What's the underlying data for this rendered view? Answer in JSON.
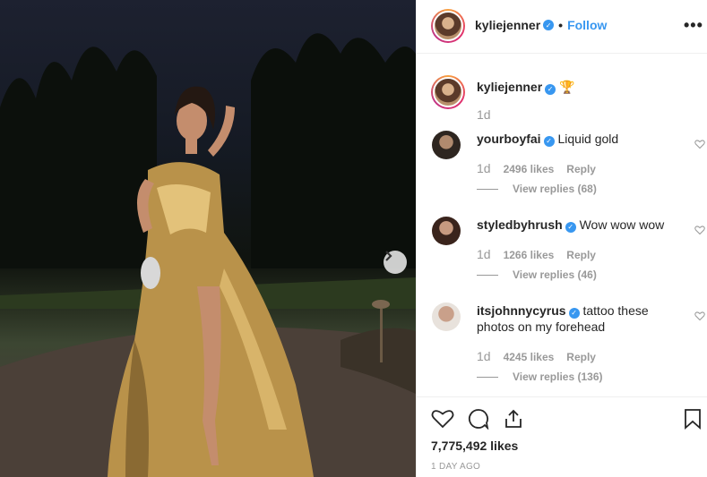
{
  "post": {
    "username": "kyliejenner",
    "follow_label": "Follow",
    "dot": "•",
    "more_label": "•••",
    "caption_emoji": "🏆",
    "caption_time": "1d",
    "likes": "7,775,492 likes",
    "posted_ago": "1 DAY AGO"
  },
  "comments": [
    {
      "username": "yourboyfai",
      "text": "Liquid gold",
      "time": "1d",
      "likes": "2496 likes",
      "reply_label": "Reply",
      "view_replies": "View replies (68)"
    },
    {
      "username": "styledbyhrush",
      "text": "Wow wow wow",
      "time": "1d",
      "likes": "1266 likes",
      "reply_label": "Reply",
      "view_replies": "View replies (46)"
    },
    {
      "username": "itsjohnnycyrus",
      "text": "tattoo these photos on my forehead",
      "time": "1d",
      "likes": "4245 likes",
      "reply_label": "Reply",
      "view_replies": "View replies (136)"
    }
  ],
  "icons": {
    "verified": "verified-badge-icon",
    "next": "chevron-right-icon",
    "heart": "heart-icon",
    "comment": "comment-icon",
    "share": "share-icon",
    "bookmark": "bookmark-icon"
  },
  "colors": {
    "link": "#3897f0",
    "muted": "#999999",
    "text": "#262626",
    "gold": "#c9a45a"
  }
}
